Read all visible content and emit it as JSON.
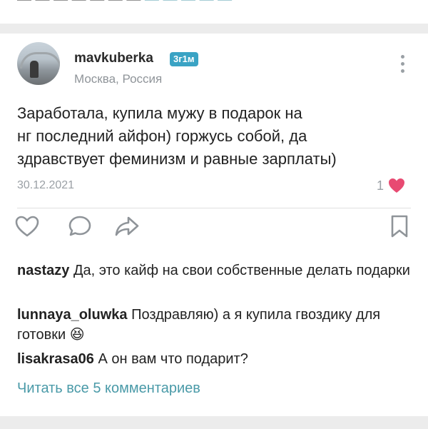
{
  "prev_post": {
    "cut_text": "— — — — — — —",
    "cut_link": "— — — — —"
  },
  "post": {
    "username": "mavkuberka",
    "time_badge": "3г1м",
    "location": "Москва, Россия",
    "text": "Заработала, купила мужу в подарок на\nнг последний айфон) горжусь собой, да\nздравствует феминизм и равные зарплаты)",
    "date": "30.12.2021",
    "likes_count": "1"
  },
  "actions": {
    "like_icon": "heart-outline-icon",
    "comment_icon": "speech-bubble-icon",
    "share_icon": "share-arrow-icon",
    "bookmark_icon": "bookmark-icon"
  },
  "comments": [
    {
      "author": "nastazy",
      "text": "Да, это кайф на свои собственные делать подарки"
    },
    {
      "author": "lunnaya_oluwka",
      "text": "Поздравляю) а я купила гвоздику для готовки 😆"
    },
    {
      "author": "lisakrasa06",
      "text": "А он вам что подарит?"
    }
  ],
  "view_all_comments": "Читать все 5 комментариев",
  "colors": {
    "accent": "#4a9aa8",
    "badge": "#3aa3c4",
    "heart": "#e84a72",
    "muted": "#9aa0a5"
  }
}
